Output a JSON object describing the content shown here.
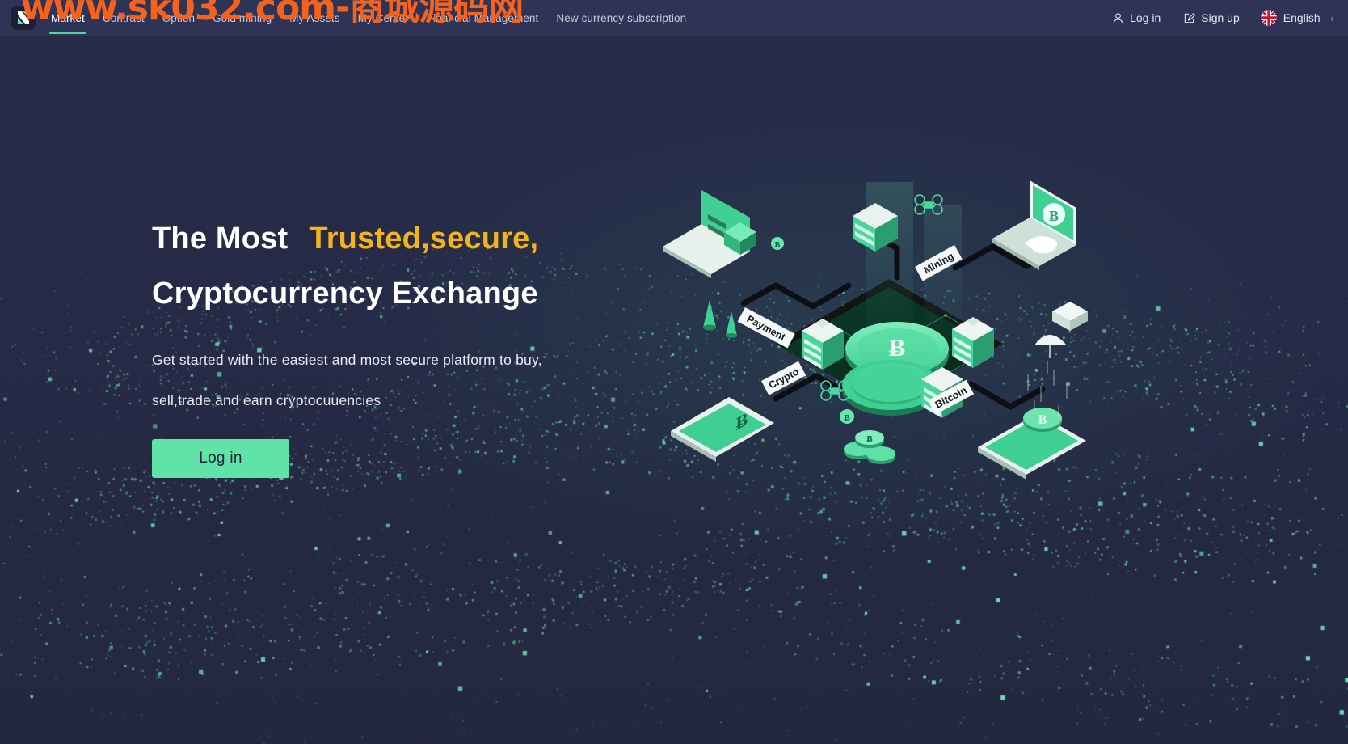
{
  "watermark": {
    "text": "www.sk032.com-商城源码网"
  },
  "navbar": {
    "logo_name": "site-logo",
    "items": [
      {
        "label": "Market",
        "active": true
      },
      {
        "label": "Contract",
        "active": false
      },
      {
        "label": "Option",
        "active": false
      },
      {
        "label": "Gold mining",
        "active": false
      },
      {
        "label": "My Assets",
        "active": false
      },
      {
        "label": "My Center",
        "active": false
      },
      {
        "label": "Financial Management",
        "active": false
      },
      {
        "label": "New currency subscription",
        "active": false
      }
    ],
    "login_label": "Log in",
    "signup_label": "Sign up",
    "language_label": "English",
    "login_icon": "user-icon",
    "signup_icon": "pencil-square-icon",
    "language_icon": "uk-flag-icon",
    "language_chevron_icon": "chevron-down-icon"
  },
  "hero": {
    "headline_part1": "The Most",
    "headline_accent": "Trusted,secure,",
    "headline_line2": "Cryptocurrency Exchange",
    "sub_line1": "Get started with the easiest and most secure platform to buy,",
    "sub_line2": "sell,trade,and earn cryptocuuencies",
    "cta_label": "Log in"
  },
  "illustration": {
    "name": "isometric-crypto-network-illustration",
    "labels": [
      "Payment",
      "Mining",
      "Crypto",
      "Bitcoin"
    ],
    "coin_symbol": "Ƀ"
  },
  "colors": {
    "background": "#262a47",
    "navbar": "#2f3356",
    "accent_green": "#5fe3a8",
    "accent_yellow": "#f2b417",
    "watermark_orange": "#f4631e",
    "text_primary": "#ffffff",
    "text_muted": "#c9ccdd"
  }
}
